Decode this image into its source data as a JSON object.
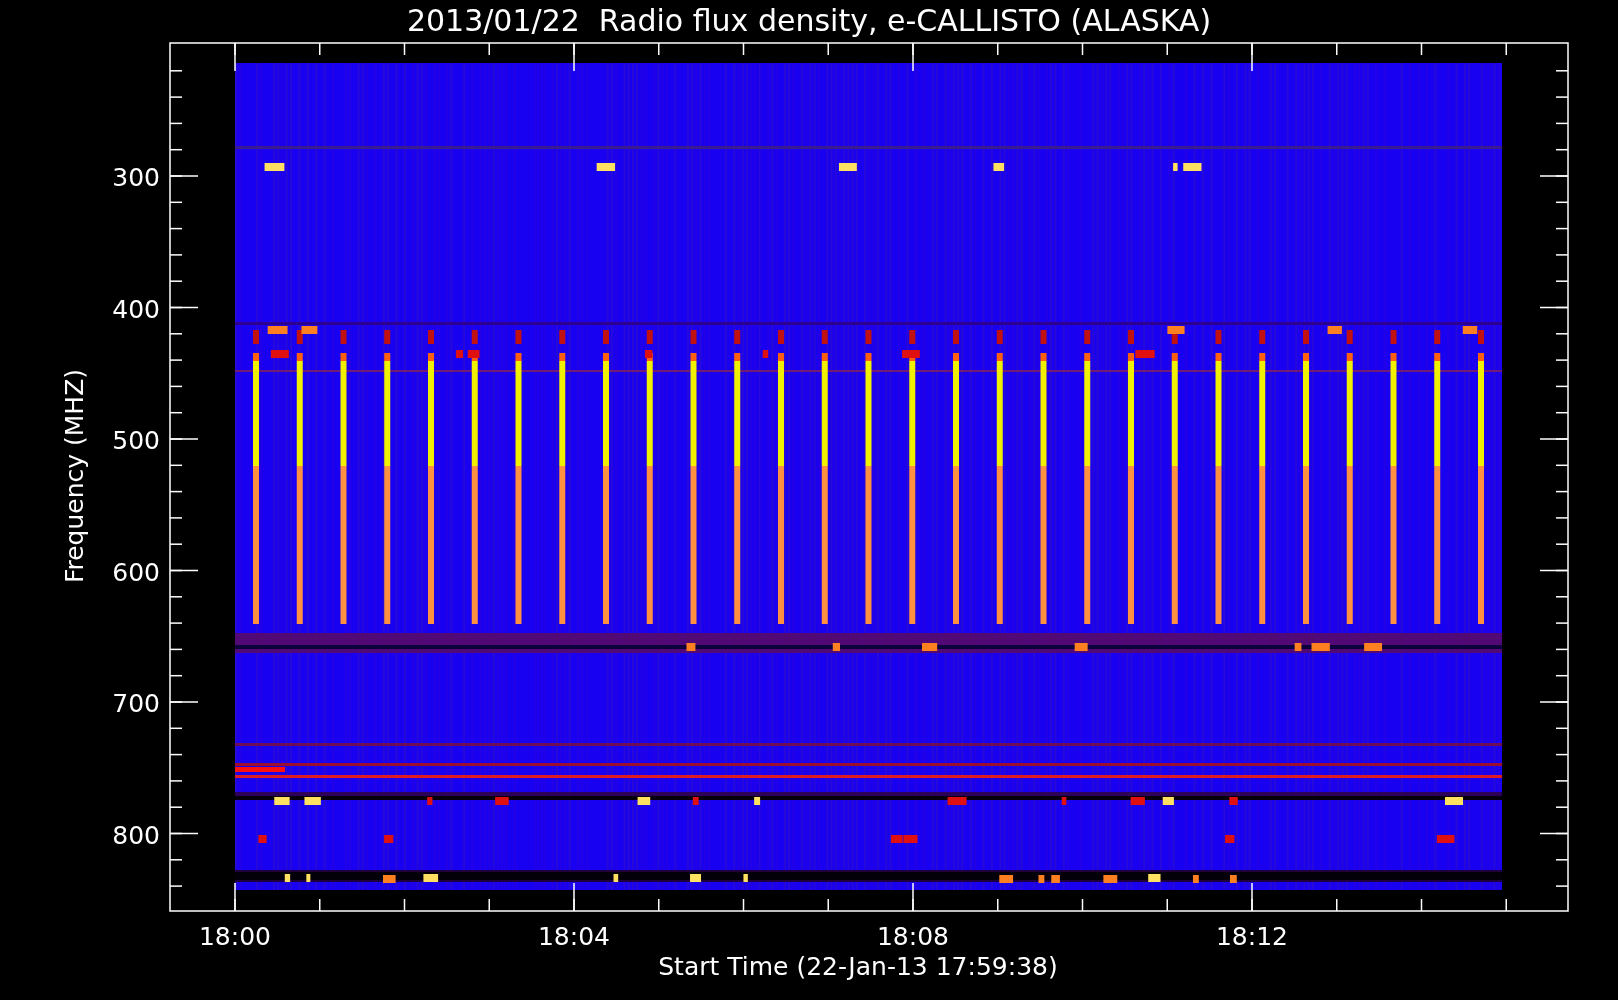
{
  "title": "2013/01/22  Radio flux density, e-CALLISTO (ALASKA)",
  "y_axis": {
    "label": "Frequency (MHZ)",
    "ticks": [
      "300",
      "400",
      "500",
      "600",
      "700",
      "800"
    ]
  },
  "x_axis": {
    "label": "Start Time (22-Jan-13 17:59:38)",
    "ticks": [
      "18:00",
      "18:04",
      "18:08",
      "18:12"
    ]
  }
}
